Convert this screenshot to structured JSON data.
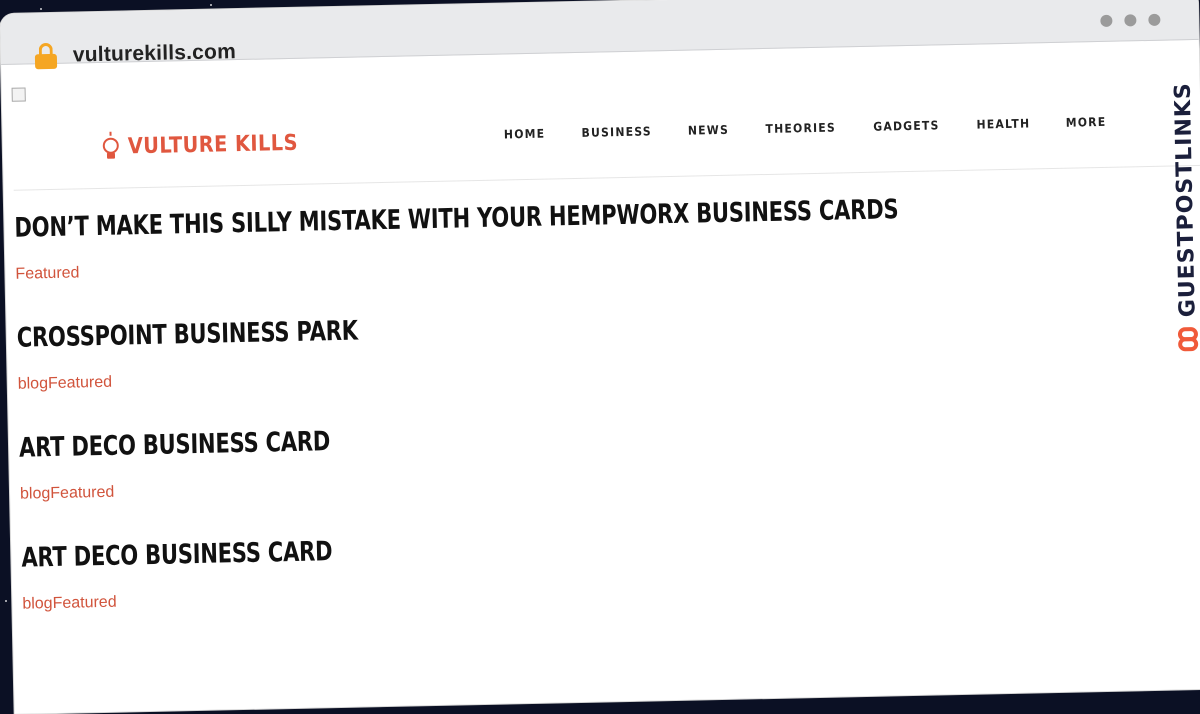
{
  "browser": {
    "url": "vulturekills.com"
  },
  "site": {
    "logo_text": "VULTURE KILLS",
    "nav": [
      "HOME",
      "BUSINESS",
      "NEWS",
      "THEORIES",
      "GADGETS",
      "HEALTH",
      "MORE"
    ]
  },
  "posts": [
    {
      "title": "DON’T MAKE THIS SILLY MISTAKE WITH YOUR HEMPWORX BUSINESS CARDS",
      "categories": [
        "Featured"
      ]
    },
    {
      "title": "CROSSPOINT BUSINESS PARK",
      "categories": [
        "blog",
        "Featured"
      ]
    },
    {
      "title": "ART DECO BUSINESS CARD",
      "categories": [
        "blog",
        "Featured"
      ]
    },
    {
      "title": "ART DECO BUSINESS CARD",
      "categories": [
        "blog",
        "Featured"
      ]
    }
  ],
  "side_brand": {
    "text": "GUESTPOSTLINKS"
  },
  "colors": {
    "accent": "#e0573f",
    "category": "#d1543c",
    "background": "#0b1024",
    "chrome": "#e9eaec"
  }
}
